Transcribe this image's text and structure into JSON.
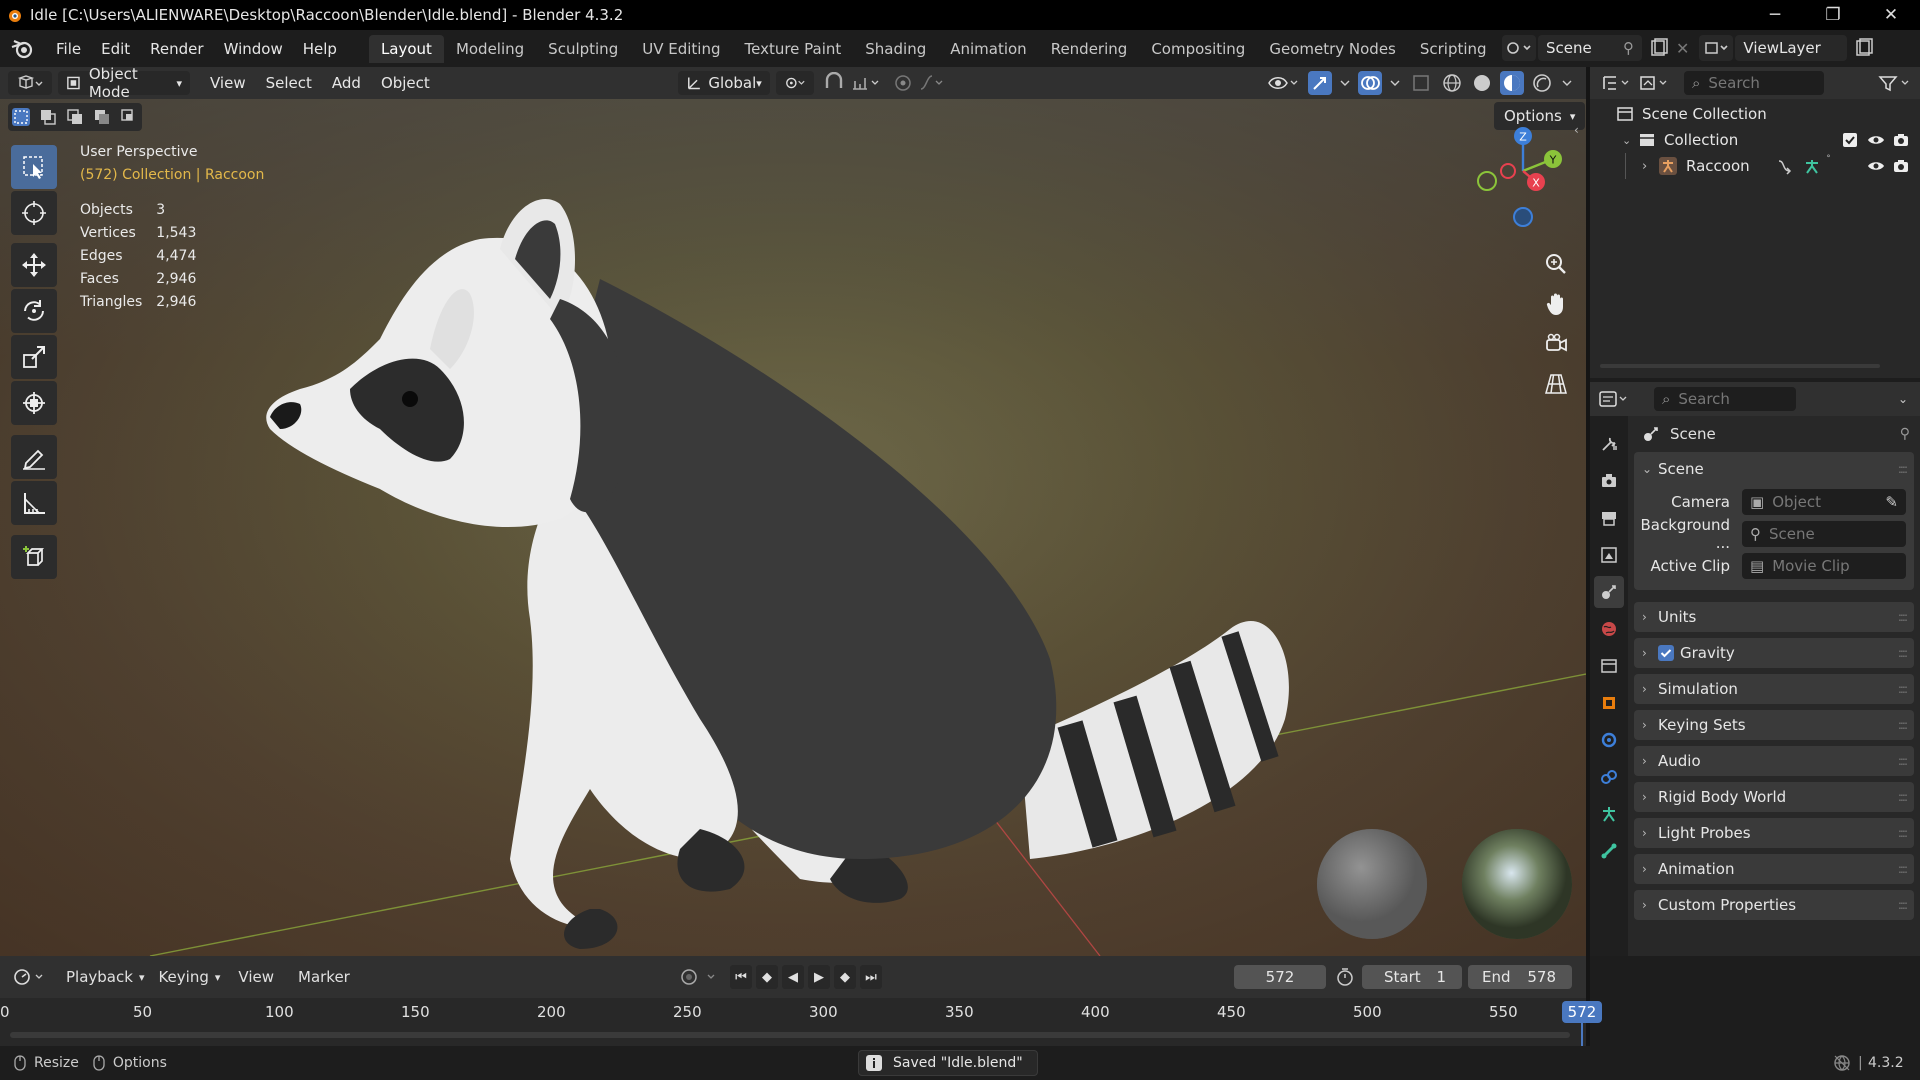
{
  "window": {
    "title": "Idle [C:\\Users\\ALIENWARE\\Desktop\\Raccoon\\Blender\\Idle.blend] - Blender 4.3.2",
    "minimize": "─",
    "maximize": "❐",
    "close": "✕"
  },
  "menu": [
    "File",
    "Edit",
    "Render",
    "Window",
    "Help"
  ],
  "workspaces": [
    "Layout",
    "Modeling",
    "Sculpting",
    "UV Editing",
    "Texture Paint",
    "Shading",
    "Animation",
    "Rendering",
    "Compositing",
    "Geometry Nodes",
    "Scripting"
  ],
  "active_workspace": "Layout",
  "scene_name": "Scene",
  "view_layer": "ViewLayer",
  "viewport_header": {
    "mode": "Object Mode",
    "menus": [
      "View",
      "Select",
      "Add",
      "Object"
    ],
    "transform_orientation": "Global",
    "options": "Options"
  },
  "overlay": {
    "view_name": "User Perspective",
    "context": "(572) Collection | Raccoon",
    "stats": [
      {
        "label": "Objects",
        "value": "3"
      },
      {
        "label": "Vertices",
        "value": "1,543"
      },
      {
        "label": "Edges",
        "value": "4,474"
      },
      {
        "label": "Faces",
        "value": "2,946"
      },
      {
        "label": "Triangles",
        "value": "2,946"
      }
    ]
  },
  "gizmo": {
    "z": "Z",
    "x": "X",
    "y": "Y"
  },
  "outliner": {
    "search_placeholder": "Search",
    "rows": [
      {
        "label": "Scene Collection"
      },
      {
        "label": "Collection"
      },
      {
        "label": "Raccoon"
      }
    ]
  },
  "properties": {
    "search_placeholder": "Search",
    "context_title": "Scene",
    "scene_panel": "Scene",
    "fields": [
      {
        "label": "Camera",
        "value": "Object"
      },
      {
        "label": "Background ...",
        "value": "Scene"
      },
      {
        "label": "Active Clip",
        "value": "Movie Clip"
      }
    ],
    "panels": [
      "Units",
      "Gravity",
      "Simulation",
      "Keying Sets",
      "Audio",
      "Rigid Body World",
      "Light Probes",
      "Animation",
      "Custom Properties"
    ],
    "gravity_checked": true
  },
  "timeline": {
    "menus": [
      "Playback",
      "Keying",
      "View",
      "Marker"
    ],
    "current_frame": "572",
    "start_label": "Start",
    "start_value": "1",
    "end_label": "End",
    "end_value": "578",
    "ruler": [
      "0",
      "50",
      "100",
      "150",
      "200",
      "250",
      "300",
      "350",
      "400",
      "450",
      "500",
      "550"
    ],
    "playhead": "572"
  },
  "statusbar": {
    "resize": "Resize",
    "options": "Options",
    "message": "Saved \"Idle.blend\"",
    "version": "4.3.2"
  },
  "colors": {
    "accent": "#4a78c0",
    "highlight": "#e3b84a",
    "x_axis": "#e8414f",
    "y_axis": "#8bc43a",
    "z_axis": "#3d7fd9"
  }
}
